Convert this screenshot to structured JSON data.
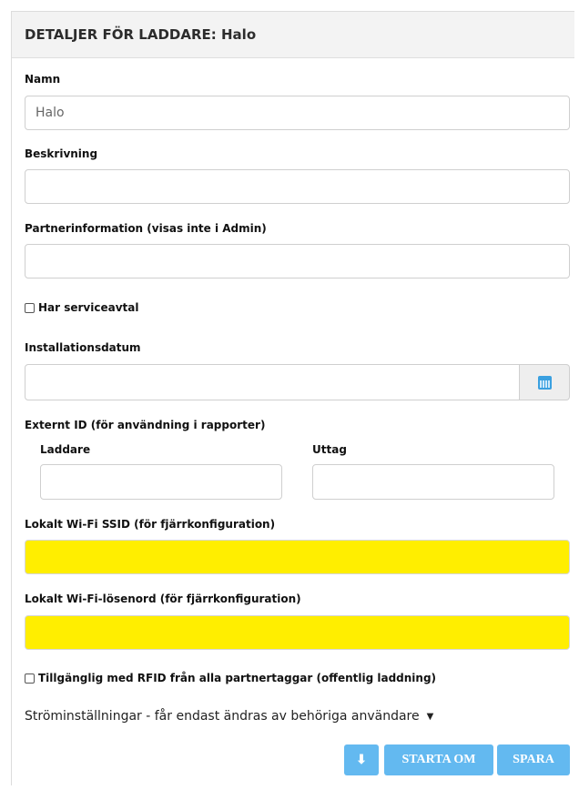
{
  "header": {
    "title": "DETALJER FÖR LADDARE: Halo"
  },
  "fields": {
    "namn": {
      "label": "Namn",
      "value": "Halo"
    },
    "beskrivning": {
      "label": "Beskrivning",
      "value": ""
    },
    "partnerinfo": {
      "label": "Partnerinformation (visas inte i Admin)",
      "value": ""
    },
    "serviceavtal": {
      "label": "Har serviceavtal",
      "checked": false
    },
    "installationsdatum": {
      "label": "Installationsdatum",
      "value": "",
      "icon": "calendar-icon"
    },
    "externt_id": {
      "label": "Externt ID (för användning i rapporter)",
      "laddare_label": "Laddare",
      "laddare_value": "",
      "uttag_label": "Uttag",
      "uttag_value": ""
    },
    "wifi_ssid": {
      "label": "Lokalt Wi-Fi SSID (för fjärrkonfiguration)",
      "value": ""
    },
    "wifi_password": {
      "label": "Lokalt Wi-Fi-lösenord (för fjärrkonfiguration)",
      "value": ""
    },
    "rfid": {
      "label": "Tillgänglig med RFID från alla partnertaggar (offentlig laddning)",
      "checked": false
    }
  },
  "power_settings": {
    "label": "Ströminställningar - får endast ändras av behöriga användare",
    "icon": "caret-down-icon"
  },
  "buttons": {
    "download_icon": "download-icon",
    "restart": "STARTA OM",
    "save": "SPARA"
  },
  "colors": {
    "highlight": "#ffee00",
    "button": "#63b9f0",
    "header_bg": "#f3f3f3"
  }
}
